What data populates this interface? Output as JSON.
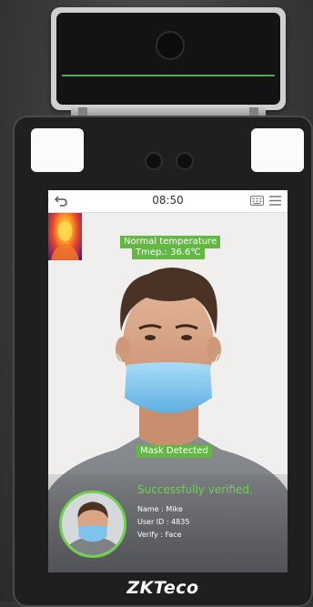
{
  "topbar": {
    "time": "08:50"
  },
  "detection": {
    "temperature_status": "Normal temperature",
    "temperature_value": "Tmep.: 36.6℃",
    "mask_status": "Mask  Detected"
  },
  "result": {
    "message": "Successfully   verified.",
    "name_line": "Name : Mike",
    "user_id_line": "User ID : 4835",
    "verify_line": "Verify : Face"
  },
  "device": {
    "brand": "ZKTeco"
  },
  "colors": {
    "accent_green": "#62b843",
    "success_green": "#6fd24c",
    "mask_blue": "#7ec3ee"
  },
  "icons": {
    "back": "back-arrow-icon",
    "keyboard": "keyboard-icon",
    "menu": "menu-icon"
  }
}
